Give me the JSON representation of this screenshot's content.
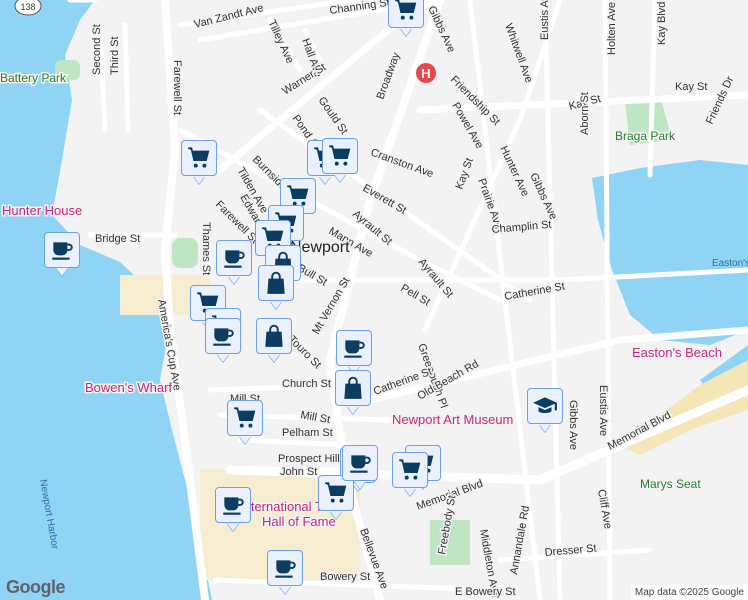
{
  "map": {
    "google_logo": "Google",
    "attribution": "Map data ©2025 Google",
    "route_shield": "138",
    "colors": {
      "water": "#8fd3f5",
      "park": "#bfe6c4",
      "road": "#ffffff",
      "marker_icon": "#0b3c61",
      "marker_border": "#6d9ee8",
      "marker_bg": "#eaf1fd"
    }
  },
  "labels": [
    {
      "text": "Van Zandt Ave",
      "kind": "street"
    },
    {
      "text": "Channing St",
      "kind": "street"
    },
    {
      "text": "Gibbs Ave",
      "kind": "street"
    },
    {
      "text": "Whitwell Ave",
      "kind": "street"
    },
    {
      "text": "Eustis Ave",
      "kind": "street"
    },
    {
      "text": "Holten Ave",
      "kind": "street"
    },
    {
      "text": "Kay Blvd",
      "kind": "street"
    },
    {
      "text": "Tilley Ave",
      "kind": "street"
    },
    {
      "text": "Hall Ave",
      "kind": "street"
    },
    {
      "text": "Broadway",
      "kind": "street"
    },
    {
      "text": "Friendship St",
      "kind": "street"
    },
    {
      "text": "Second St",
      "kind": "street"
    },
    {
      "text": "Third St",
      "kind": "street"
    },
    {
      "text": "Farewell St",
      "kind": "street"
    },
    {
      "text": "Warner St",
      "kind": "street"
    },
    {
      "text": "Gould St",
      "kind": "street"
    },
    {
      "text": "Pond Ave",
      "kind": "street"
    },
    {
      "text": "Powel Ave",
      "kind": "street"
    },
    {
      "text": "Kay St",
      "kind": "street"
    },
    {
      "text": "Kay St",
      "kind": "street"
    },
    {
      "text": "Braga Park",
      "kind": "park"
    },
    {
      "text": "Gibbs Ave",
      "kind": "street"
    },
    {
      "text": "Hunter Ave",
      "kind": "street"
    },
    {
      "text": "Aborn St",
      "kind": "street"
    },
    {
      "text": "Friends Dr",
      "kind": "street"
    },
    {
      "text": "Cranston Ave",
      "kind": "street"
    },
    {
      "text": "Burnside Ave",
      "kind": "street"
    },
    {
      "text": "Everett St",
      "kind": "street"
    },
    {
      "text": "Kay St",
      "kind": "street"
    },
    {
      "text": "Prairie Ave",
      "kind": "street"
    },
    {
      "text": "Tilden Ave",
      "kind": "street"
    },
    {
      "text": "Edward St",
      "kind": "street"
    },
    {
      "text": "Farewell St",
      "kind": "street"
    },
    {
      "text": "Ayrault St",
      "kind": "street"
    },
    {
      "text": "Mann Ave",
      "kind": "street"
    },
    {
      "text": "Champlin St",
      "kind": "street"
    },
    {
      "text": "Bridge St",
      "kind": "street"
    },
    {
      "text": "Thames St",
      "kind": "street"
    },
    {
      "text": "Hunter House",
      "kind": "poi"
    },
    {
      "text": "Easton's Pond",
      "kind": "water"
    },
    {
      "text": "Bull St",
      "kind": "street"
    },
    {
      "text": "Ayrault St",
      "kind": "street"
    },
    {
      "text": "Pell St",
      "kind": "street"
    },
    {
      "text": "Catherine St",
      "kind": "street"
    },
    {
      "text": "Mt Vernon St",
      "kind": "street"
    },
    {
      "text": "America's Cup Ave",
      "kind": "street"
    },
    {
      "text": "Greenough Pl",
      "kind": "street"
    },
    {
      "text": "Touro St",
      "kind": "street"
    },
    {
      "text": "Easton's Beach",
      "kind": "poi"
    },
    {
      "text": "Bowen's Wharf",
      "kind": "poi"
    },
    {
      "text": "Church St",
      "kind": "street"
    },
    {
      "text": "Catherine St",
      "kind": "street"
    },
    {
      "text": "Old Beach Rd",
      "kind": "street"
    },
    {
      "text": "Mill St",
      "kind": "street"
    },
    {
      "text": "Mill St",
      "kind": "street"
    },
    {
      "text": "Newport Art Museum",
      "kind": "poi"
    },
    {
      "text": "Pelham St",
      "kind": "street"
    },
    {
      "text": "Gibbs Ave",
      "kind": "street"
    },
    {
      "text": "Eustis Ave",
      "kind": "street"
    },
    {
      "text": "Memorial Blvd",
      "kind": "street"
    },
    {
      "text": "Prospect Hill St",
      "kind": "street"
    },
    {
      "text": "John St",
      "kind": "street"
    },
    {
      "text": "Memorial Blvd",
      "kind": "street"
    },
    {
      "text": "Marys Seat",
      "kind": "park"
    },
    {
      "text": "Newport Harbor",
      "kind": "water"
    },
    {
      "text": "International Tennis",
      "kind": "poi"
    },
    {
      "text": "Hall of Fame",
      "kind": "poi"
    },
    {
      "text": "Bellevue Ave",
      "kind": "street"
    },
    {
      "text": "Freebody St",
      "kind": "street"
    },
    {
      "text": "Middleton Ave",
      "kind": "street"
    },
    {
      "text": "Annandale Rd",
      "kind": "street"
    },
    {
      "text": "Cliff Ave",
      "kind": "street"
    },
    {
      "text": "Dresser St",
      "kind": "street"
    },
    {
      "text": "Bowery St",
      "kind": "street"
    },
    {
      "text": "E Bowery St",
      "kind": "street"
    },
    {
      "text": "Newport",
      "kind": "big"
    },
    {
      "text": "Battery Park",
      "kind": "park"
    }
  ],
  "markers": [
    "cart-icon",
    "cart-icon",
    "cart-icon",
    "cart-icon",
    "cart-icon",
    "cart-icon",
    "cart-icon",
    "cart-icon",
    "cart-icon",
    "cart-icon",
    "cart-icon",
    "cart-icon",
    "cart-icon",
    "cart-icon",
    "coffee-icon",
    "coffee-icon",
    "coffee-icon",
    "coffee-icon",
    "coffee-icon",
    "coffee-icon",
    "coffee-icon",
    "shopping-bag-icon",
    "shopping-bag-icon",
    "shopping-bag-icon",
    "shopping-bag-icon",
    "graduation-cap-icon"
  ]
}
